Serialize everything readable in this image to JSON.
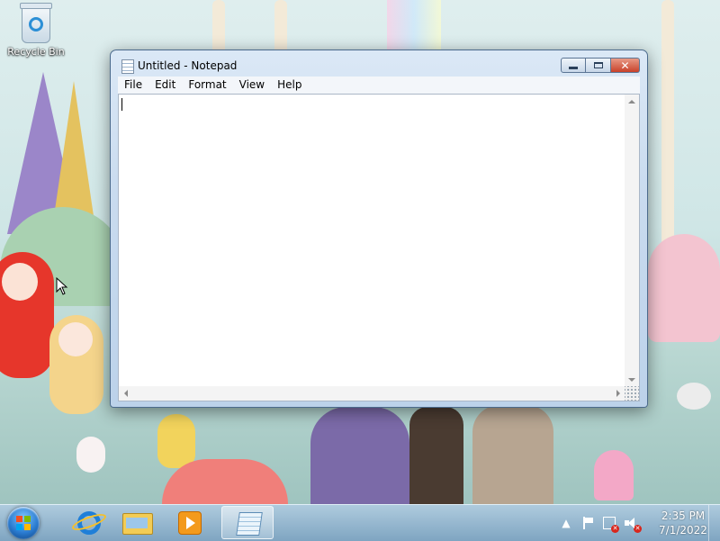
{
  "desktop": {
    "icons": [
      {
        "label": "Recycle Bin",
        "icon": "recycle-bin-icon"
      }
    ]
  },
  "window": {
    "title": "Untitled - Notepad",
    "app_icon": "notepad-icon",
    "menu": [
      "File",
      "Edit",
      "Format",
      "View",
      "Help"
    ],
    "content": "",
    "caption_buttons": {
      "minimize": "minimize-icon",
      "maximize": "maximize-icon",
      "close": "close-icon",
      "close_glyph": "✕"
    }
  },
  "taskbar": {
    "start_icon": "windows-start-icon",
    "pinned": [
      "internet-explorer-icon",
      "file-explorer-icon",
      "windows-media-player-icon",
      "notepad-icon"
    ],
    "active": "notepad-icon",
    "tray": {
      "icons": [
        "show-hidden-icons-arrow",
        "action-center-flag-icon",
        "network-error-icon",
        "volume-muted-icon"
      ],
      "arrow_glyph": "▲",
      "badge_glyph": "✕",
      "time": "2:35 PM",
      "date": "7/1/2022"
    }
  },
  "colors": {
    "window_frame": "#c9dbef",
    "close_button": "#c8412a",
    "taskbar": "#8fb4cf"
  }
}
